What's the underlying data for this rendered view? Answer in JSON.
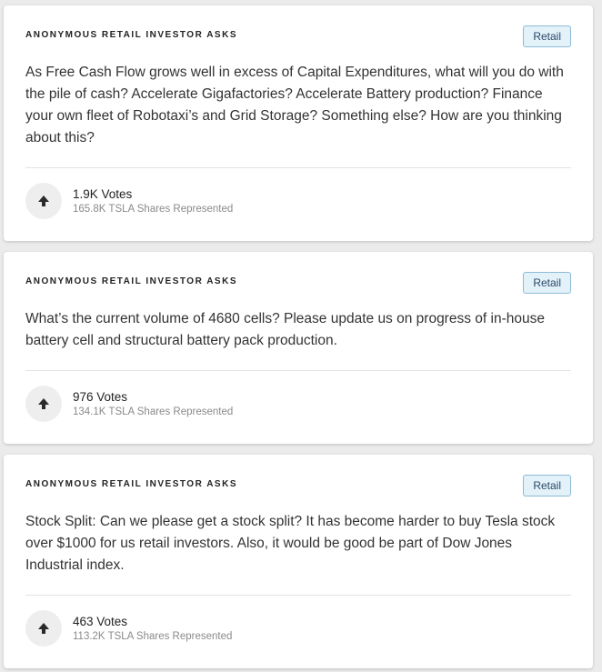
{
  "questions": [
    {
      "asker": "ANONYMOUS RETAIL INVESTOR ASKS",
      "badge": "Retail",
      "text": "As Free Cash Flow grows well in excess of Capital Expenditures, what will you do with the pile of cash? Accelerate Gigafactories? Accelerate Battery production? Finance your own fleet of Robotaxi’s and Grid Storage? Something else? How are you thinking about this?",
      "votes": "1.9K Votes",
      "shares": "165.8K TSLA Shares Represented",
      "upvote_icon": "arrow-up-icon"
    },
    {
      "asker": "ANONYMOUS RETAIL INVESTOR ASKS",
      "badge": "Retail",
      "text": "What’s the current volume of 4680 cells? Please update us on progress of in-house battery cell and structural battery pack production.",
      "votes": "976 Votes",
      "shares": "134.1K TSLA Shares Represented",
      "upvote_icon": "arrow-up-icon"
    },
    {
      "asker": "ANONYMOUS RETAIL INVESTOR ASKS",
      "badge": "Retail",
      "text": "Stock Split: Can we please get a stock split? It has become harder to buy Tesla stock over $1000 for us retail investors. Also, it would be good be part of Dow Jones Industrial index.",
      "votes": "463 Votes",
      "shares": "113.2K TSLA Shares Represented",
      "upvote_icon": "arrow-up-icon"
    }
  ],
  "colors": {
    "background": "#ebebeb",
    "card": "#ffffff",
    "badge_bg": "#e3f1f9",
    "badge_border": "#8cbcd6",
    "muted_text": "#8a8a8a"
  }
}
